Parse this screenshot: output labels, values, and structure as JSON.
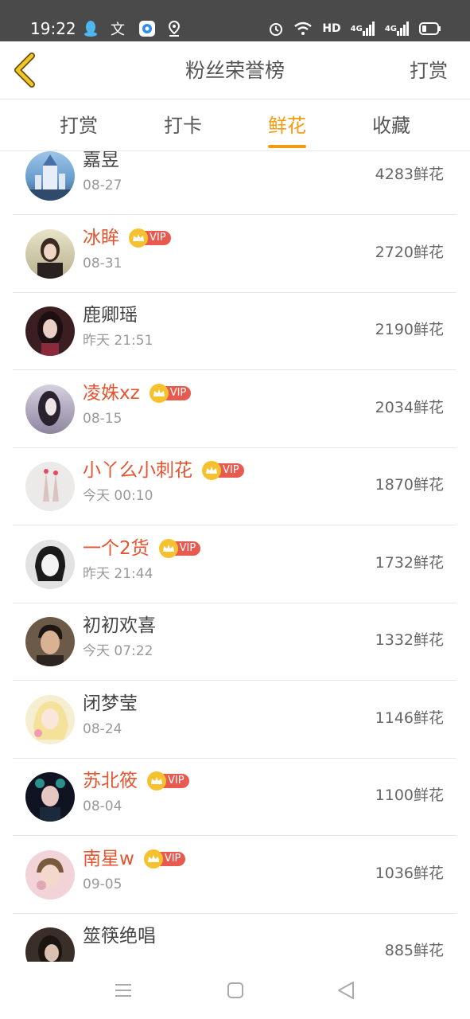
{
  "status_bar": {
    "time": "19:22",
    "network": "HD",
    "sig1": "4G",
    "sig2": "4G",
    "icons_left": [
      "qq-icon",
      "translate-icon",
      "browser-icon",
      "location-icon"
    ],
    "icons_right": [
      "alarm-icon",
      "wifi-icon",
      "signal-icon",
      "battery-icon"
    ]
  },
  "header": {
    "title": "粉丝荣誉榜",
    "action": "打赏"
  },
  "tabs": [
    {
      "label": "打赏"
    },
    {
      "label": "打卡"
    },
    {
      "label": "鲜花",
      "active": true
    },
    {
      "label": "收藏"
    }
  ],
  "colors": {
    "accent": "#f39c12",
    "vip_name": "#e5532f",
    "vip_badge": "#e85a4f",
    "crown": "#f5c12e"
  },
  "vip_label": "VIP",
  "rows": [
    {
      "name": "嘉昱",
      "time": "08-27",
      "amount": "4283鲜花",
      "vip": false
    },
    {
      "name": "冰眸",
      "time": "08-31",
      "amount": "2720鲜花",
      "vip": true
    },
    {
      "name": "鹿卿瑶",
      "time": "昨天 21:51",
      "amount": "2190鲜花",
      "vip": false
    },
    {
      "name": "凌姝xz",
      "time": "08-15",
      "amount": "2034鲜花",
      "vip": true
    },
    {
      "name": "小丫么小刺花",
      "time": "今天 00:10",
      "amount": "1870鲜花",
      "vip": true
    },
    {
      "name": "一个2货",
      "time": "昨天 21:44",
      "amount": "1732鲜花",
      "vip": true
    },
    {
      "name": "初初欢喜",
      "time": "今天 07:22",
      "amount": "1332鲜花",
      "vip": false
    },
    {
      "name": "闭梦莹",
      "time": "08-24",
      "amount": "1146鲜花",
      "vip": false
    },
    {
      "name": "苏北筱",
      "time": "08-04",
      "amount": "1100鲜花",
      "vip": true
    },
    {
      "name": "南星w",
      "time": "09-05",
      "amount": "1036鲜花",
      "vip": true
    },
    {
      "name": "筮筷绝唱",
      "time": "",
      "amount": "885鲜花",
      "vip": false
    }
  ],
  "nav_bar": [
    "menu-icon",
    "home-icon",
    "back-triangle-icon"
  ]
}
